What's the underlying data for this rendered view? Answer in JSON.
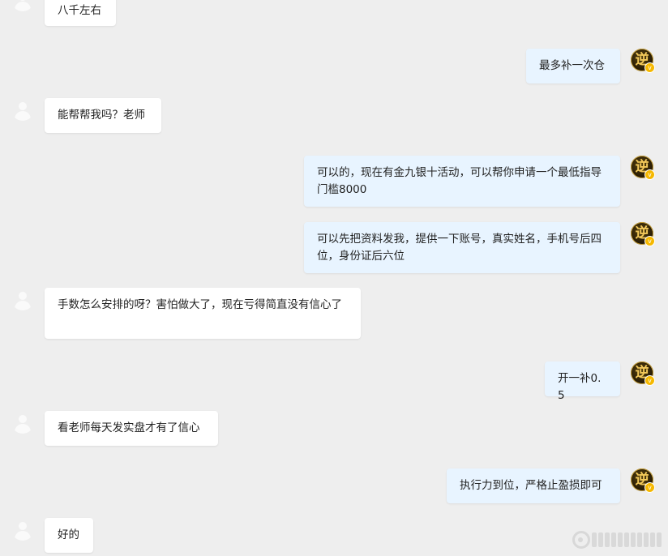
{
  "messages": [
    {
      "side": "left",
      "text": "八千左右"
    },
    {
      "side": "right",
      "text": "最多补一次仓",
      "avatar_glyph": "逆"
    },
    {
      "side": "left",
      "text": "能帮帮我吗？老师"
    },
    {
      "side": "right",
      "text": "可以的，现在有金九银十活动，可以帮你申请一个最低指导门槛8000",
      "avatar_glyph": "逆"
    },
    {
      "side": "right",
      "text": "可以先把资料发我，提供一下账号，真实姓名，手机号后四位，身份证后六位",
      "avatar_glyph": "逆"
    },
    {
      "side": "left",
      "text": "手数怎么安排的呀？害怕做大了，现在亏得简直没有信心了"
    },
    {
      "side": "right",
      "text": "开一补0.5",
      "avatar_glyph": "逆"
    },
    {
      "side": "left",
      "text": "看老师每天发实盘才有了信心"
    },
    {
      "side": "right",
      "text": "执行力到位，严格止盈损即可",
      "avatar_glyph": "逆"
    },
    {
      "side": "left",
      "text": "好的"
    }
  ],
  "icons": {
    "default_avatar": "person-silhouette-icon",
    "user_avatar": "gold-character-avatar-icon",
    "verified_badge": "v-badge-icon",
    "watermark": "weibo-watermark-icon"
  },
  "colors": {
    "background": "#eeeeee",
    "left_bubble": "#ffffff",
    "right_bubble": "#e8f4ff",
    "badge": "#f5b800"
  }
}
